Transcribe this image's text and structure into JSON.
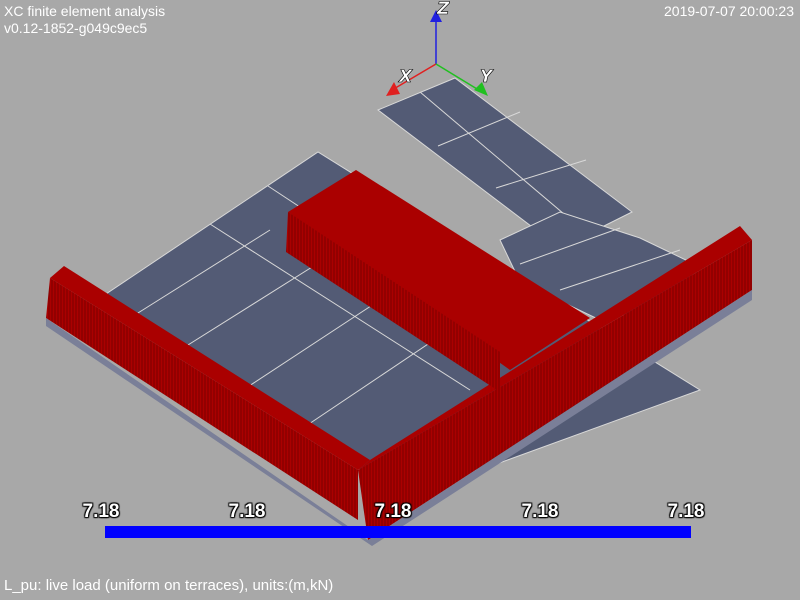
{
  "header": {
    "app_title": "XC finite element analysis",
    "version": "v0.12-1852-g049c9ec5",
    "timestamp": "2019-07-07 20:00:23"
  },
  "axes": {
    "x": "X",
    "y": "Y",
    "z": "Z"
  },
  "colors": {
    "background": "#a8a8a8",
    "slab": "#535b75",
    "load": "#aa0000",
    "scale_bar": "#0000ff",
    "axis_x": "#e02020",
    "axis_y": "#20c020",
    "axis_z": "#2020e0"
  },
  "scale": {
    "tick_labels": [
      "7.18",
      "7.18",
      "7.18",
      "7.18",
      "7.18"
    ]
  },
  "footer": {
    "caption": "L_pu: live load (uniform on terraces), units:(m,kN)"
  }
}
